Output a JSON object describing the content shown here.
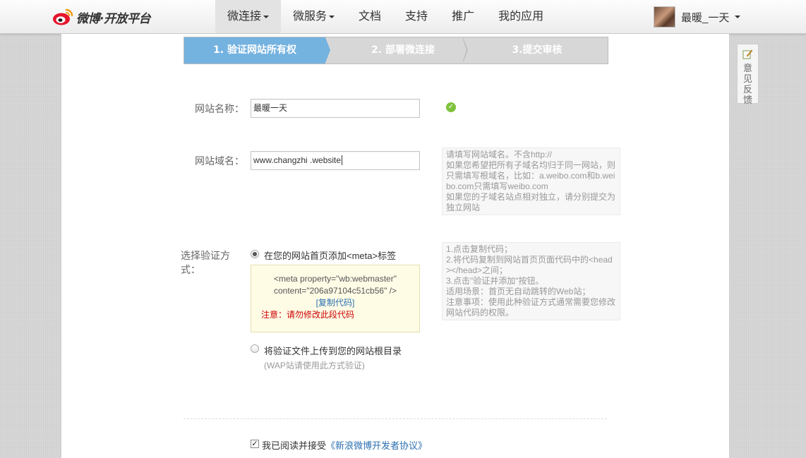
{
  "header": {
    "logo_text": "微博·开放平台",
    "nav": [
      {
        "label": "微连接",
        "dropdown": true,
        "active": true
      },
      {
        "label": "微服务",
        "dropdown": true,
        "active": false
      },
      {
        "label": "文档",
        "dropdown": false,
        "active": false
      },
      {
        "label": "支持",
        "dropdown": false,
        "active": false
      },
      {
        "label": "推广",
        "dropdown": false,
        "active": false
      },
      {
        "label": "我的应用",
        "dropdown": false,
        "active": false
      }
    ],
    "user_name": "最暖_一天"
  },
  "steps": [
    {
      "label": "1. 验证网站所有权",
      "state": "active"
    },
    {
      "label": "2. 部署微连接",
      "state": "inactive"
    },
    {
      "label": "3.提交审核",
      "state": "inactive"
    }
  ],
  "form": {
    "site_name": {
      "label": "网站名称：",
      "value": "最暖一天",
      "status": "valid"
    },
    "site_domain": {
      "label": "网站域名：",
      "value": "www.changzhi .website",
      "tip": [
        "请填写网站域名。不含http://",
        "如果您希望把所有子域名均归于同一网站，则只需填写根域名，比如：a.weibo.com和b.weibo.com只需填写weibo.com",
        "如果您的子域名站点相对独立，请分别提交为独立网站"
      ]
    },
    "verify_method": {
      "label": "选择验证方式：",
      "options": [
        {
          "label": "在您的网站首页添加<meta>标签",
          "selected": true
        },
        {
          "label": "将验证文件上传到您的网站根目录",
          "sub": "(WAP站请使用此方式验证)",
          "selected": false
        }
      ],
      "code": "<meta property=\"wb:webmaster\" content=\"206a97104c51cb56\" />",
      "copy_link": "[复制代码]",
      "warning": "注意：请勿修改此段代码",
      "tip": [
        "1.点击复制代码；",
        "2.将代码复制到网站首页页面代码中的<head></head>之间；",
        "3.点击\"验证并添加\"按钮。",
        "适用场景：首页无自动跳转的Web站；",
        "注意事项：使用此种验证方式通常需要您修改网站代码的权限。"
      ]
    },
    "agreement": {
      "checked": true,
      "prefix": "我已阅读并接受",
      "link": "《新浪微博开发者协议》"
    }
  },
  "feedback": {
    "label": "意见反馈"
  },
  "colors": {
    "step_active": "#74b2e0",
    "ok": "#7fc23c",
    "link": "#2a6fb0",
    "warning": "#cc0000"
  }
}
